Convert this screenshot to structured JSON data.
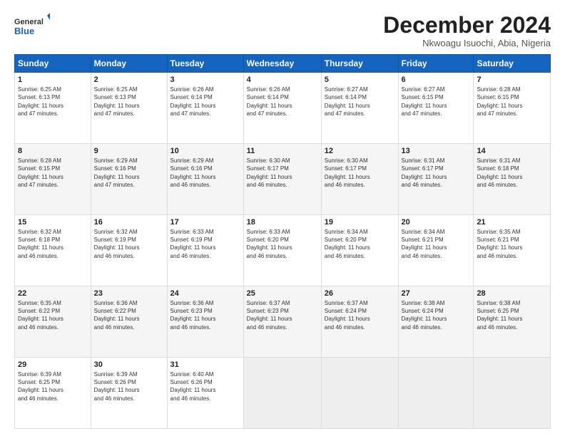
{
  "header": {
    "logo_general": "General",
    "logo_blue": "Blue",
    "month_title": "December 2024",
    "location": "Nkwoagu Isuochi, Abia, Nigeria"
  },
  "days_of_week": [
    "Sunday",
    "Monday",
    "Tuesday",
    "Wednesday",
    "Thursday",
    "Friday",
    "Saturday"
  ],
  "weeks": [
    [
      {
        "day": "1",
        "info": "Sunrise: 6:25 AM\nSunset: 6:13 PM\nDaylight: 11 hours\nand 47 minutes."
      },
      {
        "day": "2",
        "info": "Sunrise: 6:25 AM\nSunset: 6:13 PM\nDaylight: 11 hours\nand 47 minutes."
      },
      {
        "day": "3",
        "info": "Sunrise: 6:26 AM\nSunset: 6:14 PM\nDaylight: 11 hours\nand 47 minutes."
      },
      {
        "day": "4",
        "info": "Sunrise: 6:26 AM\nSunset: 6:14 PM\nDaylight: 11 hours\nand 47 minutes."
      },
      {
        "day": "5",
        "info": "Sunrise: 6:27 AM\nSunset: 6:14 PM\nDaylight: 11 hours\nand 47 minutes."
      },
      {
        "day": "6",
        "info": "Sunrise: 6:27 AM\nSunset: 6:15 PM\nDaylight: 11 hours\nand 47 minutes."
      },
      {
        "day": "7",
        "info": "Sunrise: 6:28 AM\nSunset: 6:15 PM\nDaylight: 11 hours\nand 47 minutes."
      }
    ],
    [
      {
        "day": "8",
        "info": "Sunrise: 6:28 AM\nSunset: 6:15 PM\nDaylight: 11 hours\nand 47 minutes."
      },
      {
        "day": "9",
        "info": "Sunrise: 6:29 AM\nSunset: 6:16 PM\nDaylight: 11 hours\nand 47 minutes."
      },
      {
        "day": "10",
        "info": "Sunrise: 6:29 AM\nSunset: 6:16 PM\nDaylight: 11 hours\nand 46 minutes."
      },
      {
        "day": "11",
        "info": "Sunrise: 6:30 AM\nSunset: 6:17 PM\nDaylight: 11 hours\nand 46 minutes."
      },
      {
        "day": "12",
        "info": "Sunrise: 6:30 AM\nSunset: 6:17 PM\nDaylight: 11 hours\nand 46 minutes."
      },
      {
        "day": "13",
        "info": "Sunrise: 6:31 AM\nSunset: 6:17 PM\nDaylight: 11 hours\nand 46 minutes."
      },
      {
        "day": "14",
        "info": "Sunrise: 6:31 AM\nSunset: 6:18 PM\nDaylight: 11 hours\nand 46 minutes."
      }
    ],
    [
      {
        "day": "15",
        "info": "Sunrise: 6:32 AM\nSunset: 6:18 PM\nDaylight: 11 hours\nand 46 minutes."
      },
      {
        "day": "16",
        "info": "Sunrise: 6:32 AM\nSunset: 6:19 PM\nDaylight: 11 hours\nand 46 minutes."
      },
      {
        "day": "17",
        "info": "Sunrise: 6:33 AM\nSunset: 6:19 PM\nDaylight: 11 hours\nand 46 minutes."
      },
      {
        "day": "18",
        "info": "Sunrise: 6:33 AM\nSunset: 6:20 PM\nDaylight: 11 hours\nand 46 minutes."
      },
      {
        "day": "19",
        "info": "Sunrise: 6:34 AM\nSunset: 6:20 PM\nDaylight: 11 hours\nand 46 minutes."
      },
      {
        "day": "20",
        "info": "Sunrise: 6:34 AM\nSunset: 6:21 PM\nDaylight: 11 hours\nand 46 minutes."
      },
      {
        "day": "21",
        "info": "Sunrise: 6:35 AM\nSunset: 6:21 PM\nDaylight: 11 hours\nand 46 minutes."
      }
    ],
    [
      {
        "day": "22",
        "info": "Sunrise: 6:35 AM\nSunset: 6:22 PM\nDaylight: 11 hours\nand 46 minutes."
      },
      {
        "day": "23",
        "info": "Sunrise: 6:36 AM\nSunset: 6:22 PM\nDaylight: 11 hours\nand 46 minutes."
      },
      {
        "day": "24",
        "info": "Sunrise: 6:36 AM\nSunset: 6:23 PM\nDaylight: 11 hours\nand 46 minutes."
      },
      {
        "day": "25",
        "info": "Sunrise: 6:37 AM\nSunset: 6:23 PM\nDaylight: 11 hours\nand 46 minutes."
      },
      {
        "day": "26",
        "info": "Sunrise: 6:37 AM\nSunset: 6:24 PM\nDaylight: 11 hours\nand 46 minutes."
      },
      {
        "day": "27",
        "info": "Sunrise: 6:38 AM\nSunset: 6:24 PM\nDaylight: 11 hours\nand 46 minutes."
      },
      {
        "day": "28",
        "info": "Sunrise: 6:38 AM\nSunset: 6:25 PM\nDaylight: 11 hours\nand 46 minutes."
      }
    ],
    [
      {
        "day": "29",
        "info": "Sunrise: 6:39 AM\nSunset: 6:25 PM\nDaylight: 11 hours\nand 46 minutes."
      },
      {
        "day": "30",
        "info": "Sunrise: 6:39 AM\nSunset: 6:26 PM\nDaylight: 11 hours\nand 46 minutes."
      },
      {
        "day": "31",
        "info": "Sunrise: 6:40 AM\nSunset: 6:26 PM\nDaylight: 11 hours\nand 46 minutes."
      },
      {
        "day": "",
        "info": ""
      },
      {
        "day": "",
        "info": ""
      },
      {
        "day": "",
        "info": ""
      },
      {
        "day": "",
        "info": ""
      }
    ]
  ]
}
